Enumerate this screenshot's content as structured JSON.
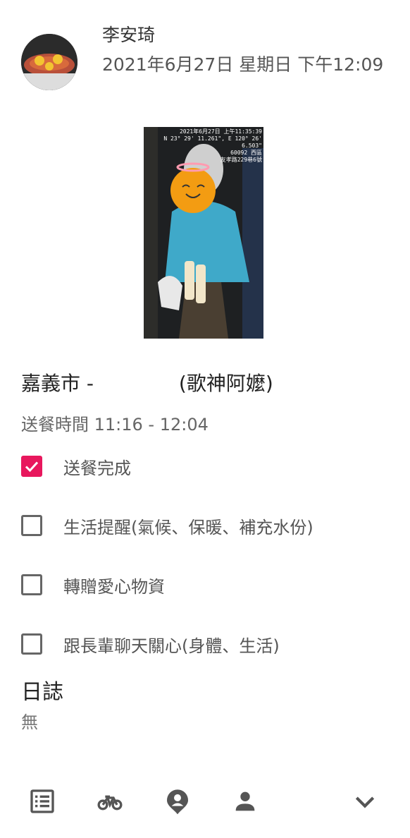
{
  "post": {
    "author": "李安琦",
    "datetime": "2021年6月27日 星期日 下午12:09",
    "photo_stamp": [
      "2021年6月27日 上午11:35:39",
      "N 23° 29' 11.261\", E 120° 26' 6.503\"",
      "60092 西區",
      "友孝路229巷6號"
    ],
    "title_prefix": "嘉義市 - ",
    "title_suffix": "(歌神阿嬤)",
    "delivery_time": "送餐時間 11:16 - 12:04"
  },
  "tasks": [
    {
      "label": "送餐完成",
      "checked": true
    },
    {
      "label": "生活提醒(氣候、保暖、補充水份)",
      "checked": false
    },
    {
      "label": "轉贈愛心物資",
      "checked": false
    },
    {
      "label": "跟長輩聊天關心(身體、生活)",
      "checked": false
    }
  ],
  "log": {
    "title": "日誌",
    "value": "無"
  },
  "nav": {
    "icons": [
      "list-icon",
      "bicycle-icon",
      "location-person-icon",
      "person-icon",
      "chevron-down-icon"
    ]
  },
  "colors": {
    "accent": "#e8175d",
    "icon_gray": "#555555"
  }
}
